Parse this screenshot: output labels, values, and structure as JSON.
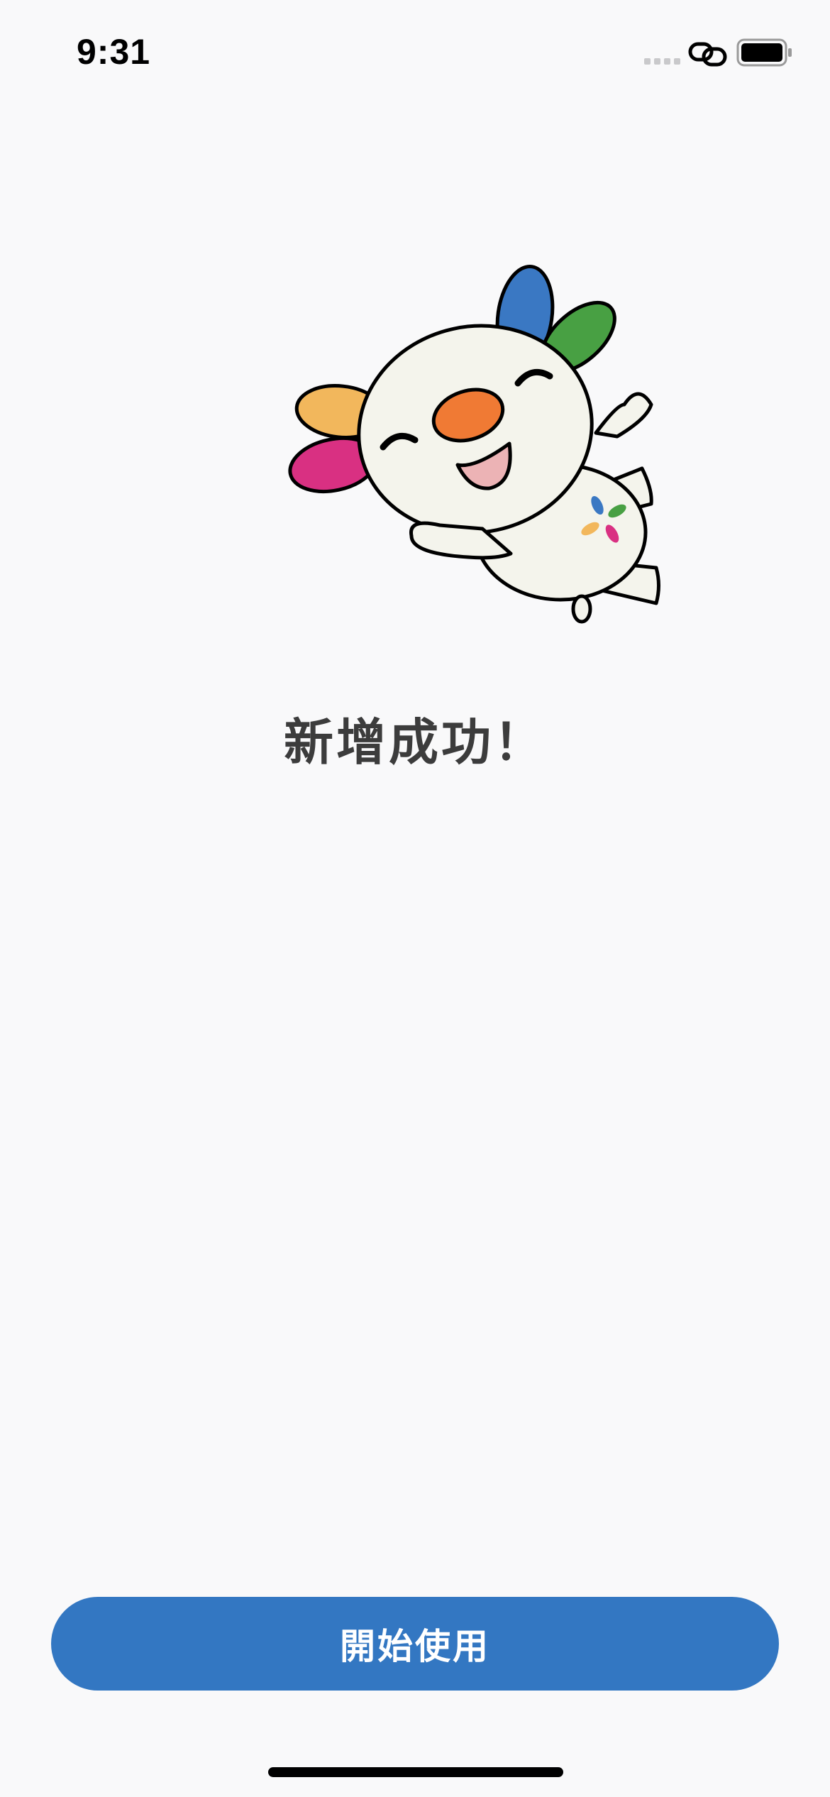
{
  "status_bar": {
    "time": "9:31",
    "icons": [
      "signal-dots-icon",
      "link-icon",
      "battery-icon"
    ]
  },
  "mascot": {
    "icon": "mascot-character-icon",
    "petal_colors": [
      "#3a78c3",
      "#48a043",
      "#f2b75c",
      "#d93082"
    ],
    "nose_color": "#f07a34"
  },
  "message": {
    "title": "新增成功！"
  },
  "actions": {
    "start_label": "開始使用"
  },
  "colors": {
    "background": "#f9f9fa",
    "accent": "#3377c2",
    "title_text": "#3c3c3c"
  }
}
